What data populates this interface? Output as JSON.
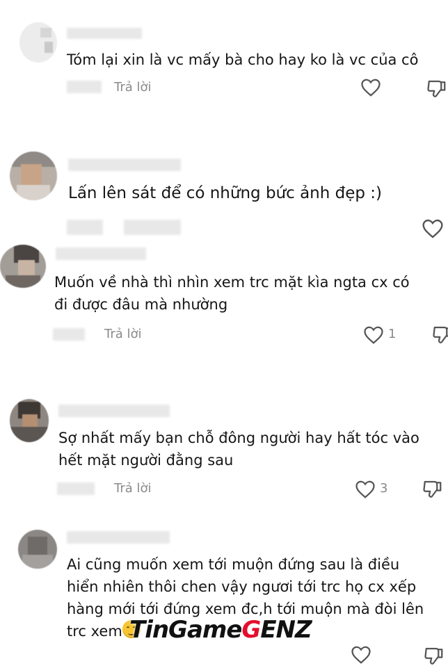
{
  "comments": [
    {
      "text": "Tóm lại xin là vc mấy bà cho hay ko là vc của cô",
      "reply": "Trả lời",
      "likes": ""
    },
    {
      "text": "Lấn lên sát để có những bức ảnh đẹp :)",
      "reply": "",
      "likes": ""
    },
    {
      "text_lines": [
        "Muốn về nhà thì nhìn xem trc mặt kìa ngta cx có",
        "đi được đâu mà nhường"
      ],
      "reply": "Trả lời",
      "likes": "1"
    },
    {
      "text_lines": [
        "Sợ nhất mấy bạn chỗ đông người hay hất tóc vào",
        "hết mặt người đằng sau"
      ],
      "reply": "Trả lời",
      "likes": "3"
    },
    {
      "text_lines": [
        "Ai cũng muốn xem tới muộn đứng sau là điều",
        "hiển nhiên thôi chen vậy ngươi tới trc họ cx xếp",
        "hàng mới tới đứng xem đc,h tới muộn mà đòi lên",
        "trc xem"
      ]
    }
  ],
  "watermark": {
    "part1": "TinGame",
    "part2": "G",
    "part3": "ENZ"
  },
  "colors": {
    "text": "#161616",
    "muted": "#8a8a8a",
    "brand_red": "#e30f2d"
  },
  "icons": [
    "heart-icon",
    "dislike-icon",
    "emoji-icon"
  ]
}
